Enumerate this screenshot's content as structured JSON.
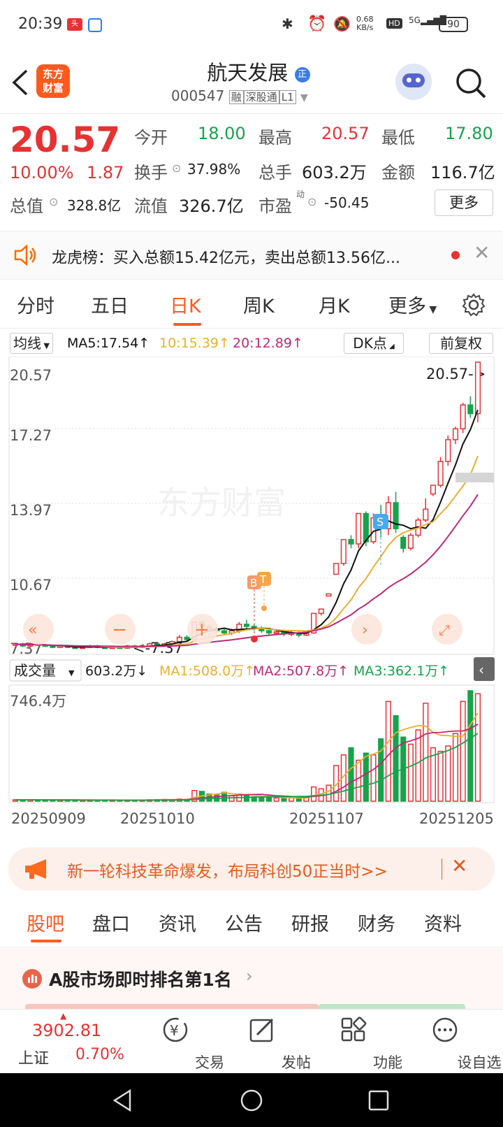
{
  "status": {
    "time": "20:39",
    "speed_top": "0.68",
    "speed_bottom": "KB/s",
    "battery": "90",
    "net": "5G"
  },
  "header": {
    "name": "航天发展",
    "code": "000547",
    "badges": [
      "融",
      "深股通",
      "L1"
    ],
    "logo_line1": "东方",
    "logo_line2": "财富"
  },
  "quote": {
    "price": "20.57",
    "change_pct": "10.00%",
    "change": "1.87",
    "open_label": "今开",
    "open": "18.00",
    "high_label": "最高",
    "high": "20.57",
    "low_label": "最低",
    "low": "17.80",
    "turnover_label": "换手",
    "turnover": "37.98%",
    "volume_label": "总手",
    "volume": "603.2万",
    "amount_label": "金额",
    "amount": "116.7亿",
    "mcap_label": "总值",
    "mcap": "328.8亿",
    "float_label": "流值",
    "float": "326.7亿",
    "pe_label": "市盈",
    "pe_sup": "动",
    "pe": "-50.45",
    "more": "更多"
  },
  "lhb": {
    "text": "龙虎榜：买入总额15.42亿元，卖出总额13.56亿..."
  },
  "tabs": [
    "分时",
    "五日",
    "日K",
    "周K",
    "月K",
    "更多"
  ],
  "active_tab": 2,
  "chart_bar": {
    "ma_label": "均线",
    "ma5": "MA5:17.54↑",
    "ma10": "10:15.39↑",
    "ma20": "20:12.89↑",
    "dk": "DK点",
    "fq": "前复权"
  },
  "price_axis": [
    "20.57",
    "17.27",
    "13.97",
    "10.67",
    "7.37"
  ],
  "max_marker": "20.57->",
  "min_marker": "<-7.37",
  "watermark": "东方财富",
  "volume_bar": {
    "label": "成交量",
    "vol": "603.2万↓",
    "ma1": "MA1:508.0万↑",
    "ma2": "MA2:507.8万↑",
    "ma3": "MA3:362.1万↑",
    "max": "746.4万"
  },
  "dates": [
    "20250909",
    "20251010",
    "20251107",
    "20251205"
  ],
  "colors": {
    "up": "#e63232",
    "down": "#17a34a",
    "ma5": "#111111",
    "ma10": "#e8b030",
    "ma20": "#c0287a",
    "accent": "#ff6a00"
  },
  "chart_data": {
    "type": "candlestick",
    "y_axis": [
      7.37,
      20.57
    ],
    "volume_max": "746.4万",
    "candles": [
      [
        7.6,
        7.6,
        7.5,
        7.6
      ],
      [
        7.6,
        7.5,
        7.45,
        7.65
      ],
      [
        7.5,
        7.6,
        7.45,
        7.65
      ],
      [
        7.6,
        7.55,
        7.5,
        7.65
      ],
      [
        7.55,
        7.5,
        7.45,
        7.6
      ],
      [
        7.5,
        7.45,
        7.4,
        7.55
      ],
      [
        7.45,
        7.5,
        7.4,
        7.55
      ],
      [
        7.5,
        7.45,
        7.4,
        7.55
      ],
      [
        7.45,
        7.4,
        7.37,
        7.5
      ],
      [
        7.4,
        7.45,
        7.37,
        7.5
      ],
      [
        7.45,
        7.5,
        7.4,
        7.55
      ],
      [
        7.5,
        7.45,
        7.4,
        7.55
      ],
      [
        7.45,
        7.4,
        7.37,
        7.5
      ],
      [
        7.4,
        7.45,
        7.37,
        7.5
      ],
      [
        7.45,
        7.4,
        7.37,
        7.5
      ],
      [
        7.4,
        7.5,
        7.37,
        7.55
      ],
      [
        7.5,
        7.45,
        7.4,
        7.55
      ],
      [
        7.45,
        7.5,
        7.4,
        7.55
      ],
      [
        7.5,
        7.6,
        7.45,
        7.65
      ],
      [
        7.6,
        7.55,
        7.5,
        7.65
      ],
      [
        7.55,
        7.6,
        7.5,
        7.65
      ],
      [
        7.6,
        7.7,
        7.55,
        7.75
      ],
      [
        7.7,
        7.9,
        7.65,
        8.0
      ],
      [
        7.9,
        7.8,
        7.7,
        8.0
      ],
      [
        7.8,
        8.6,
        7.75,
        8.6
      ],
      [
        8.6,
        8.4,
        8.3,
        8.7
      ],
      [
        8.4,
        8.3,
        8.2,
        8.5
      ],
      [
        8.3,
        8.2,
        8.1,
        8.4
      ],
      [
        8.2,
        8.1,
        8.0,
        8.3
      ],
      [
        8.1,
        8.2,
        8.0,
        8.3
      ],
      [
        8.2,
        8.5,
        8.1,
        8.6
      ],
      [
        8.5,
        8.4,
        8.3,
        8.7
      ],
      [
        8.4,
        8.3,
        8.2,
        8.5
      ],
      [
        8.3,
        8.2,
        8.1,
        8.4
      ],
      [
        8.2,
        8.1,
        8.0,
        8.3
      ],
      [
        8.1,
        8.15,
        8.0,
        8.25
      ],
      [
        8.15,
        8.05,
        7.95,
        8.25
      ],
      [
        8.05,
        8.1,
        7.95,
        8.2
      ],
      [
        8.1,
        8.0,
        7.9,
        8.2
      ],
      [
        8.0,
        8.1,
        7.95,
        8.2
      ],
      [
        8.1,
        9.0,
        8.05,
        9.0
      ],
      [
        9.0,
        9.2,
        8.9,
        9.2
      ],
      [
        9.8,
        9.9,
        9.8,
        9.9
      ],
      [
        10.8,
        11.3,
        10.8,
        11.3
      ],
      [
        11.3,
        12.4,
        11.2,
        12.4
      ],
      [
        12.4,
        12.2,
        12.0,
        12.6
      ],
      [
        12.2,
        13.6,
        12.0,
        13.6
      ],
      [
        13.6,
        12.3,
        12.1,
        13.7
      ],
      [
        12.3,
        13.4,
        12.2,
        13.6
      ],
      [
        13.4,
        12.9,
        12.5,
        14.0
      ],
      [
        12.9,
        14.1,
        12.6,
        14.4
      ],
      [
        14.1,
        12.9,
        12.7,
        14.6
      ],
      [
        12.5,
        12.0,
        11.8,
        12.6
      ],
      [
        12.0,
        12.6,
        11.9,
        12.7
      ],
      [
        12.6,
        13.3,
        12.5,
        13.4
      ],
      [
        13.3,
        13.8,
        13.2,
        14.3
      ],
      [
        14.5,
        14.9,
        14.4,
        14.9
      ],
      [
        14.9,
        16.0,
        14.8,
        16.2
      ],
      [
        16.0,
        17.0,
        15.8,
        17.2
      ],
      [
        17.0,
        17.5,
        16.8,
        17.6
      ],
      [
        17.5,
        18.6,
        17.3,
        18.7
      ],
      [
        18.6,
        18.2,
        18.0,
        19.0
      ],
      [
        18.2,
        20.57,
        17.8,
        20.57
      ]
    ],
    "volumes": [
      8,
      7,
      8,
      7,
      6,
      7,
      6,
      6,
      7,
      6,
      6,
      5,
      6,
      6,
      5,
      6,
      6,
      7,
      8,
      9,
      10,
      9,
      12,
      11,
      60,
      55,
      40,
      35,
      50,
      30,
      40,
      30,
      25,
      22,
      20,
      18,
      17,
      20,
      18,
      20,
      80,
      70,
      90,
      200,
      260,
      300,
      230,
      270,
      260,
      350,
      560,
      480,
      360,
      320,
      400,
      550,
      300,
      280,
      310,
      380,
      560,
      620,
      603.2
    ],
    "ma5_last": 17.54,
    "ma10_last": 15.39,
    "ma20_last": 12.89
  },
  "banner": {
    "text": "新一轮科技革命爆发，布局科创50正当时>>"
  },
  "subtabs": [
    "股吧",
    "盘口",
    "资讯",
    "公告",
    "研报",
    "财务",
    "资料"
  ],
  "rank": {
    "text": "A股市场即时排名第1名"
  },
  "bottom": {
    "index_value": "3902.81",
    "index_name": "上证",
    "index_pct": "0.70%",
    "items": [
      "交易",
      "发帖",
      "功能",
      "设自选"
    ]
  }
}
